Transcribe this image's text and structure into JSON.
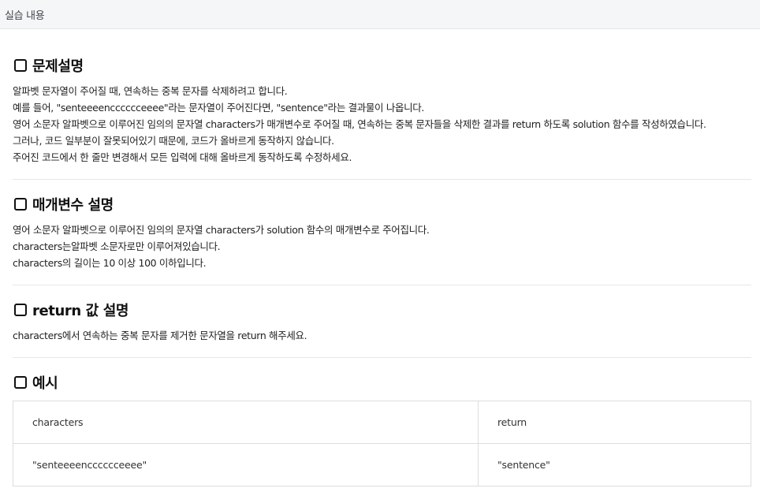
{
  "header": {
    "title": "실습 내용"
  },
  "sections": {
    "problem": {
      "title": "문제설명",
      "lines": [
        "알파벳 문자열이 주어질 때, 연속하는 중복 문자를 삭제하려고 합니다.",
        "예를 들어, \"senteeeencccccceeee\"라는 문자열이 주어진다면, \"sentence\"라는 결과물이 나옵니다.",
        "영어 소문자 알파벳으로 이루어진 임의의 문자열 characters가 매개변수로 주어질 때, 연속하는 중복 문자들을 삭제한 결과를 return 하도록 solution 함수를 작성하였습니다.",
        "그러나, 코드 일부분이 잘못되어있기 때문에, 코드가 올바르게 동작하지 않습니다.",
        "주어진 코드에서 한 줄만 변경해서 모든 입력에 대해 올바르게 동작하도록 수정하세요."
      ]
    },
    "params": {
      "title": "매개변수 설명",
      "lines": [
        "영어 소문자 알파벳으로 이루어진 임의의 문자열 characters가 solution 함수의 매개변수로 주어집니다.",
        "characters는알파벳 소문자로만 이루어져있습니다.",
        "characters의 길이는 10 이상 100 이하입니다."
      ]
    },
    "return_desc": {
      "title": "return 값 설명",
      "lines": [
        "characters에서 연속하는 중복 문자를 제거한 문자열을 return 해주세요."
      ]
    },
    "example": {
      "title": "예시",
      "columns": [
        "characters",
        "return"
      ],
      "rows": [
        [
          "\"senteeeencccccceeee\"",
          "\"sentence\""
        ]
      ]
    }
  }
}
